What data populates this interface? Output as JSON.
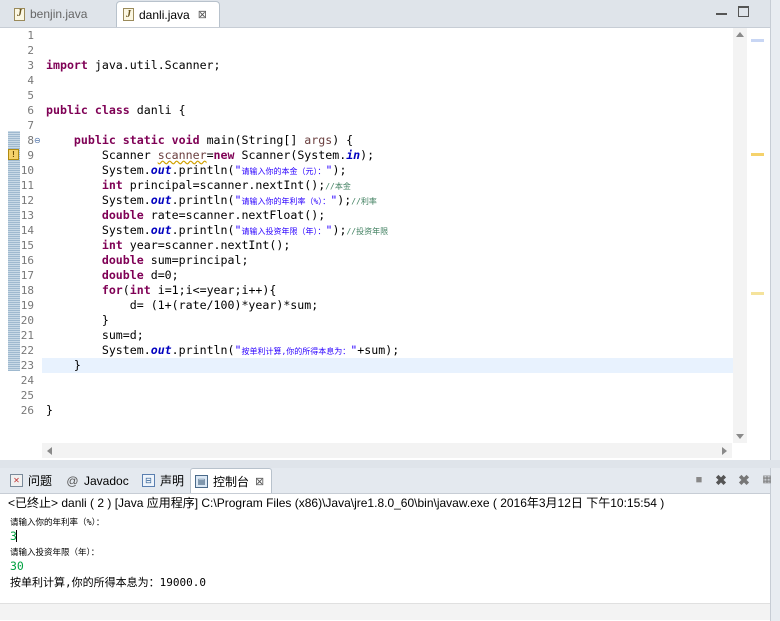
{
  "editor": {
    "tabs": [
      {
        "label": "benjin.java",
        "active": false
      },
      {
        "label": "danli.java",
        "active": true,
        "close": "⊠"
      }
    ],
    "line_numbers": [
      "1",
      "2",
      "3",
      "4",
      "5",
      "6",
      "7",
      "8",
      "9",
      "10",
      "11",
      "12",
      "13",
      "14",
      "15",
      "16",
      "17",
      "18",
      "19",
      "20",
      "21",
      "22",
      "23",
      "24",
      "25",
      "26"
    ],
    "current_line": 23
  },
  "code": {
    "l3_kw": "import",
    "l3_rest": " java.util.Scanner;",
    "l6_kw1": "public",
    "l6_kw2": "class",
    "l6_rest": " danli {",
    "l8_kw1": "public",
    "l8_kw2": "static",
    "l8_kw3": "void",
    "l8_rest": " main(String[] ",
    "l8_args": "args",
    "l8_end": ") {",
    "l9_a": "Scanner ",
    "l9_var": "scanner",
    "l9_b": "=",
    "l9_kw": "new",
    "l9_c": " Scanner(System.",
    "l9_fld": "in",
    "l9_d": ");",
    "l10_a": "System.",
    "l10_fld": "out",
    "l10_b": ".println(",
    "l10_q1": "\"",
    "l10_str": "请输入你的本金（元）：",
    "l10_q2": "\"",
    "l10_c": ");",
    "l11_kw": "int",
    "l11_a": " principal=scanner.nextInt();",
    "l11_cmt": "//本金",
    "l12_a": "System.",
    "l12_fld": "out",
    "l12_b": ".println(",
    "l12_q1": "\"",
    "l12_str": "请输入你的年利率（%）：",
    "l12_q2": "\"",
    "l12_c": ");",
    "l12_cmt": "//利率",
    "l13_kw": "double",
    "l13_a": " rate=scanner.nextFloat();",
    "l14_a": "System.",
    "l14_fld": "out",
    "l14_b": ".println(",
    "l14_q1": "\"",
    "l14_str": "请输入投资年限（年）：",
    "l14_q2": "\"",
    "l14_c": ");",
    "l14_cmt": "//投资年限",
    "l15_kw": "int",
    "l15_a": " year=scanner.nextInt();",
    "l16_kw": "double",
    "l16_a": " sum=principal;",
    "l17_kw": "double",
    "l17_a": " d=0;",
    "l18_kw1": "for",
    "l18_a": "(",
    "l18_kw2": "int",
    "l18_b": " i=1;i<=year;i++){",
    "l19_a": "d= (1+(rate/100)*year)*sum;",
    "l20_a": "}",
    "l21_a": "sum=d;",
    "l22_a": "System.",
    "l22_fld": "out",
    "l22_b": ".println(",
    "l22_q1": "\"",
    "l22_str": "按单利计算,你的所得本息为：",
    "l22_q2": "\"",
    "l22_c": "+sum);",
    "l23_a": "}",
    "l26_a": "}"
  },
  "panel": {
    "tabs": [
      {
        "label": "问题",
        "icon": "problems-icon"
      },
      {
        "label": "Javadoc",
        "icon": "at-icon",
        "glyph": "@"
      },
      {
        "label": "声明",
        "icon": "declaration-icon"
      },
      {
        "label": "控制台",
        "icon": "console-icon",
        "active": true,
        "close": "⊠"
      }
    ],
    "console_header": "<已终止> danli ( 2 )  [Java 应用程序] C:\\Program Files (x86)\\Java\\jre1.8.0_60\\bin\\javaw.exe ( 2016年3月12日 下午10:15:54 )",
    "output": [
      {
        "text": "请输入你的年利率（%）：",
        "kind": "out"
      },
      {
        "text": "3",
        "kind": "input"
      },
      {
        "text": "请输入投资年限（年）：",
        "kind": "out"
      },
      {
        "text": "30",
        "kind": "input"
      },
      {
        "text": "按单利计算,你的所得本息为：19000.0",
        "kind": "out"
      }
    ]
  },
  "colors": {
    "keyword": "#7f0055",
    "field": "#0000c0",
    "string": "#2a00ff",
    "comment": "#3f7f5f",
    "console_input": "#00a040",
    "current_line": "#e8f2fe"
  }
}
